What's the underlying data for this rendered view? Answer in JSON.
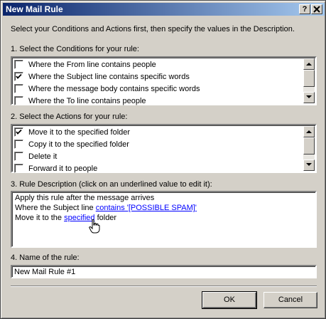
{
  "window": {
    "title": "New Mail Rule",
    "help_button": "?",
    "close_button": "X"
  },
  "instructions": "Select your Conditions and Actions first, then specify the values in the Description.",
  "conditions": {
    "label": "1. Select the Conditions for your rule:",
    "items": [
      {
        "label": "Where the From line contains people",
        "checked": false
      },
      {
        "label": "Where the Subject line contains specific words",
        "checked": true
      },
      {
        "label": "Where the message body contains specific words",
        "checked": false
      },
      {
        "label": "Where the To line contains people",
        "checked": false
      }
    ]
  },
  "actions": {
    "label": "2. Select the Actions for your rule:",
    "items": [
      {
        "label": "Move it to the specified folder",
        "checked": true
      },
      {
        "label": "Copy it to the specified folder",
        "checked": false
      },
      {
        "label": "Delete it",
        "checked": false
      },
      {
        "label": "Forward it to people",
        "checked": false
      }
    ]
  },
  "description": {
    "label": "3. Rule Description (click on an underlined value to edit it):",
    "line1": "Apply this rule after the message arrives",
    "line2_prefix": "Where the Subject line ",
    "line2_link": "contains '[POSSIBLE SPAM]'",
    "line3_prefix": "Move it to the ",
    "line3_link": "specified",
    "line3_suffix": " folder"
  },
  "name": {
    "label": "4. Name of the rule:",
    "value": "New Mail Rule #1"
  },
  "buttons": {
    "ok": "OK",
    "cancel": "Cancel"
  },
  "icons": [
    "help-icon",
    "close-icon",
    "checkmark-icon",
    "scroll-up-arrow-icon",
    "scroll-down-arrow-icon",
    "hand-pointer-cursor-icon"
  ]
}
